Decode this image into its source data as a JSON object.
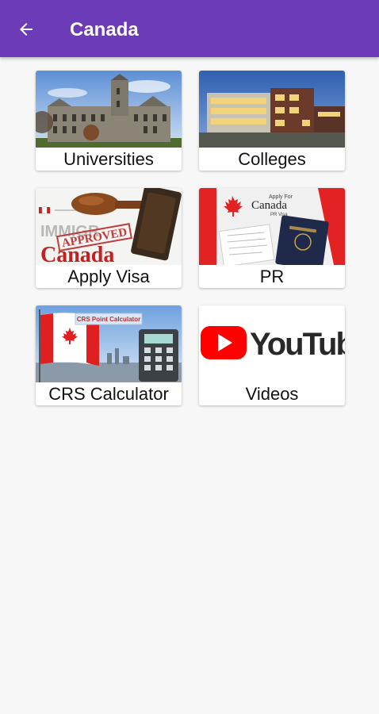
{
  "app_bar": {
    "title": "Canada",
    "back_icon": "arrow-left-icon",
    "color": "#6c3bb8"
  },
  "tiles": [
    {
      "label": "Universities",
      "image": "university-building-photo"
    },
    {
      "label": "Colleges",
      "image": "college-building-photo"
    },
    {
      "label": "Apply Visa",
      "image": "approved-canada-stamp-photo",
      "image_text": [
        "IMMIGR",
        "APPROVED",
        "Canada"
      ]
    },
    {
      "label": "PR",
      "image": "canada-pr-visa-passport-photo",
      "image_text": [
        "Apply For",
        "Canada",
        "PR Visa"
      ]
    },
    {
      "label": "CRS Calculator",
      "image": "canada-flag-calculator-photo",
      "image_text": [
        "CRS Point Calculator"
      ]
    },
    {
      "label": "Videos",
      "image": "youtube-logo",
      "image_text": [
        "YouTube"
      ]
    }
  ]
}
